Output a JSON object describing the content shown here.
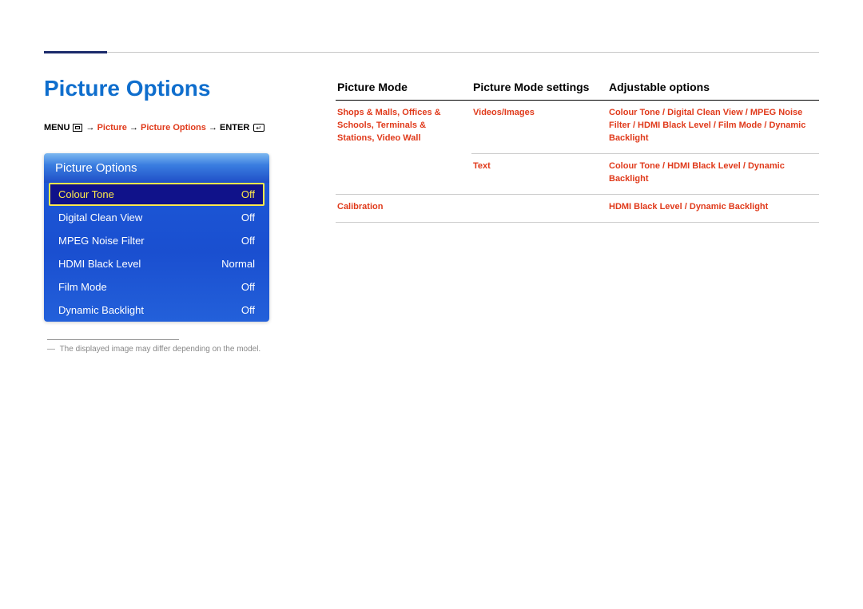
{
  "page": {
    "title": "Picture Options",
    "footnote": "The displayed image may differ depending on the model."
  },
  "breadcrumb": {
    "menu": "MENU",
    "arrow": " → ",
    "picture": "Picture",
    "pictureOptions": "Picture Options",
    "enter": "ENTER"
  },
  "menu": {
    "header": "Picture Options",
    "items": [
      {
        "label": "Colour Tone",
        "value": "Off",
        "selected": true
      },
      {
        "label": "Digital Clean View",
        "value": "Off",
        "selected": false
      },
      {
        "label": "MPEG Noise Filter",
        "value": "Off",
        "selected": false
      },
      {
        "label": "HDMI Black Level",
        "value": "Normal",
        "selected": false
      },
      {
        "label": "Film Mode",
        "value": "Off",
        "selected": false
      },
      {
        "label": "Dynamic Backlight",
        "value": "Off",
        "selected": false
      }
    ]
  },
  "table": {
    "headers": {
      "mode": "Picture Mode",
      "settings": "Picture Mode settings",
      "options": "Adjustable options"
    },
    "rows": [
      {
        "mode": "Shops & Malls, Offices & Schools, Terminals & Stations, Video Wall",
        "settings": "Videos/Images",
        "options": "Colour Tone / Digital Clean View / MPEG Noise Filter / HDMI Black Level / Film Mode / Dynamic Backlight"
      },
      {
        "mode": "",
        "settings": "Text",
        "options": "Colour Tone / HDMI Black Level / Dynamic Backlight"
      },
      {
        "mode": "Calibration",
        "settings": "",
        "options": "HDMI Black Level / Dynamic Backlight"
      }
    ]
  }
}
